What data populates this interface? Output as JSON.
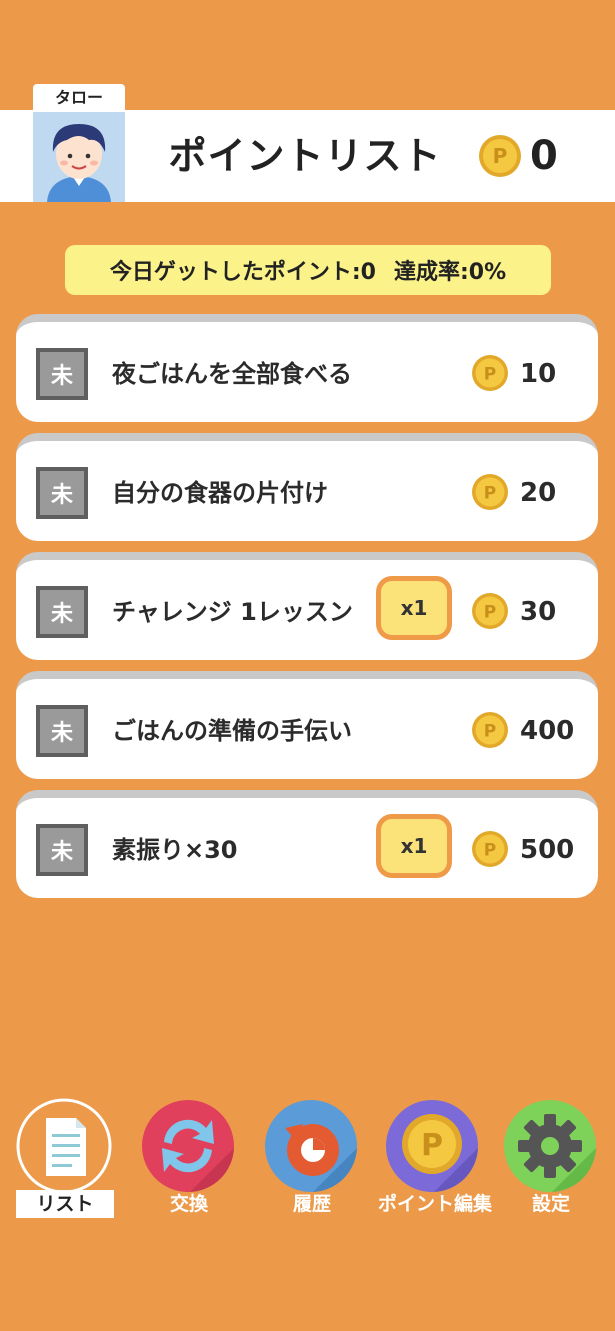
{
  "user": {
    "name": "タロー"
  },
  "header": {
    "title": "ポイントリスト",
    "points": "0"
  },
  "summary": {
    "today_label": "今日ゲットしたポイント:0",
    "rate_label": "達成率:0%"
  },
  "tasks": [
    {
      "status": "未",
      "title": "夜ごはんを全部食べる",
      "points": "10",
      "multiplier": ""
    },
    {
      "status": "未",
      "title": "自分の食器の片付け",
      "points": "20",
      "multiplier": ""
    },
    {
      "status": "未",
      "title": "チャレンジ 1レッスン",
      "points": "30",
      "multiplier": "x1"
    },
    {
      "status": "未",
      "title": "ごはんの準備の手伝い",
      "points": "400",
      "multiplier": ""
    },
    {
      "status": "未",
      "title": "素振り×30",
      "points": "500",
      "multiplier": "x1"
    }
  ],
  "nav": {
    "items": [
      {
        "label": "リスト",
        "icon": "document-icon",
        "active": true
      },
      {
        "label": "交換",
        "icon": "exchange-icon",
        "active": false
      },
      {
        "label": "履歴",
        "icon": "history-icon",
        "active": false
      },
      {
        "label": "ポイント編集",
        "icon": "coin-icon",
        "active": false
      },
      {
        "label": "設定",
        "icon": "gear-icon",
        "active": false
      }
    ]
  },
  "colors": {
    "background": "#ec9a4a",
    "summary_bg": "#fbf38a",
    "coin": "#f5c842",
    "status_box": "#9a9a9a"
  }
}
